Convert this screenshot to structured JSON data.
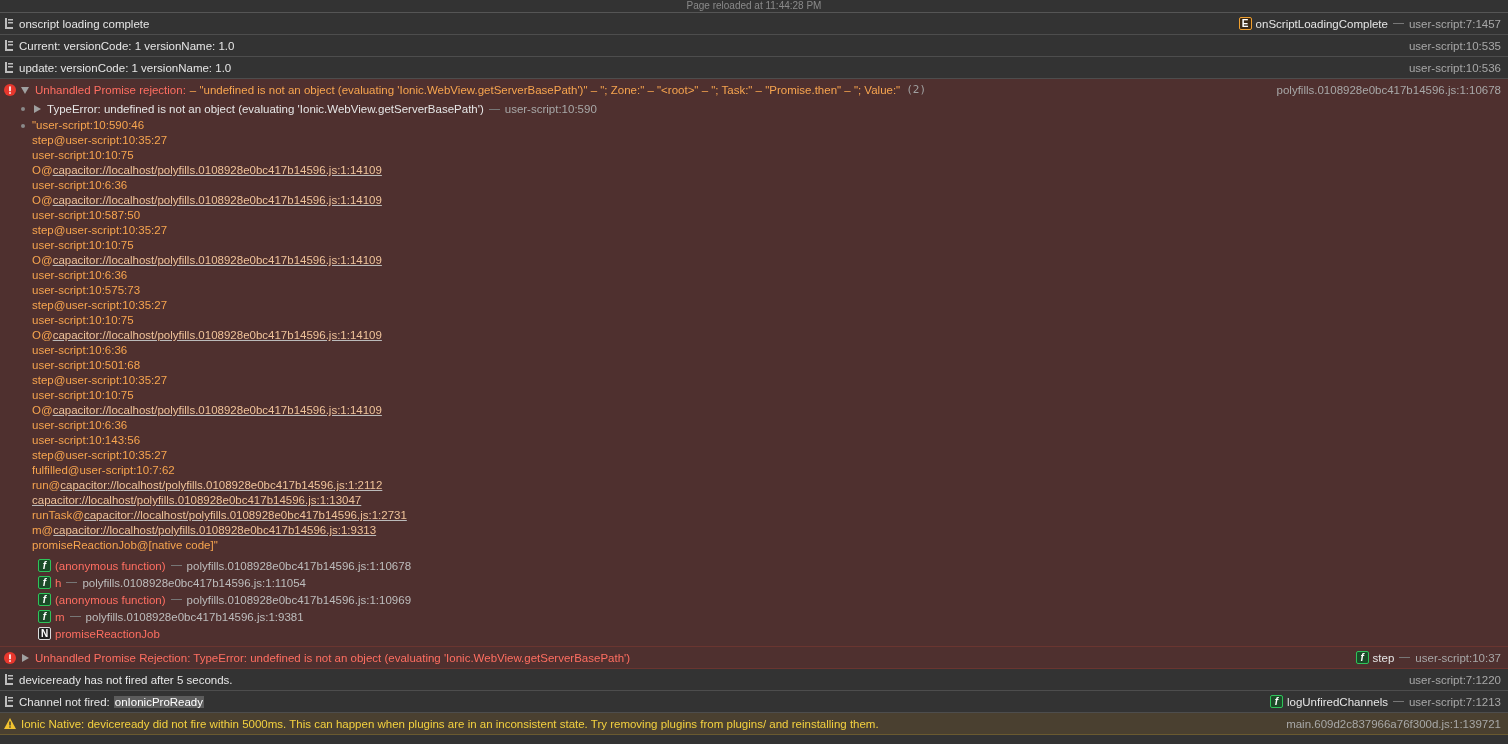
{
  "reload_notice": "Page reloaded at 11:44:28 PM",
  "messages": [
    {
      "kind": "log",
      "text": "onscript loading complete",
      "badge": {
        "kind": "event",
        "letter": "E"
      },
      "function": "onScriptLoadingComplete",
      "location": "user-script:7:1457"
    },
    {
      "kind": "log",
      "text": "Current: versionCode: 1 versionName: 1.0",
      "location": "user-script:10:535"
    },
    {
      "kind": "log",
      "text": "update: versionCode: 1 versionName: 1.0",
      "location": "user-script:10:536"
    },
    {
      "kind": "error",
      "expanded": true,
      "title": "Unhandled Promise rejection:",
      "text": "– \"undefined is not an object (evaluating 'Ionic.WebView.getServerBasePath')\" – \"; Zone:\" – \"<root>\" – \"; Task:\" – \"Promise.then\" – \"; Value:\"",
      "count": "(2)",
      "location": "polyfills.0108928e0bc417b14596.js:1:10678",
      "detail": {
        "expanded": false,
        "text": "TypeError: undefined is not an object (evaluating 'Ionic.WebView.getServerBasePath')",
        "location": "user-script:10:590"
      },
      "stack": [
        {
          "prefix": "\"user-script:10:590:46"
        },
        {
          "prefix": "step@user-script:10:35:27"
        },
        {
          "prefix": "user-script:10:10:75"
        },
        {
          "prefix": "O@",
          "link": "capacitor://localhost/polyfills.0108928e0bc417b14596.js:1:14109"
        },
        {
          "prefix": "user-script:10:6:36"
        },
        {
          "prefix": "O@",
          "link": "capacitor://localhost/polyfills.0108928e0bc417b14596.js:1:14109"
        },
        {
          "prefix": "user-script:10:587:50"
        },
        {
          "prefix": "step@user-script:10:35:27"
        },
        {
          "prefix": "user-script:10:10:75"
        },
        {
          "prefix": "O@",
          "link": "capacitor://localhost/polyfills.0108928e0bc417b14596.js:1:14109"
        },
        {
          "prefix": "user-script:10:6:36"
        },
        {
          "prefix": "user-script:10:575:73"
        },
        {
          "prefix": "step@user-script:10:35:27"
        },
        {
          "prefix": "user-script:10:10:75"
        },
        {
          "prefix": "O@",
          "link": "capacitor://localhost/polyfills.0108928e0bc417b14596.js:1:14109"
        },
        {
          "prefix": "user-script:10:6:36"
        },
        {
          "prefix": "user-script:10:501:68"
        },
        {
          "prefix": "step@user-script:10:35:27"
        },
        {
          "prefix": "user-script:10:10:75"
        },
        {
          "prefix": "O@",
          "link": "capacitor://localhost/polyfills.0108928e0bc417b14596.js:1:14109"
        },
        {
          "prefix": "user-script:10:6:36"
        },
        {
          "prefix": "user-script:10:143:56"
        },
        {
          "prefix": "step@user-script:10:35:27"
        },
        {
          "prefix": "fulfilled@user-script:10:7:62"
        },
        {
          "prefix": "run@",
          "link": "capacitor://localhost/polyfills.0108928e0bc417b14596.js:1:2112"
        },
        {
          "link": "capacitor://localhost/polyfills.0108928e0bc417b14596.js:1:13047"
        },
        {
          "prefix": "runTask@",
          "link": "capacitor://localhost/polyfills.0108928e0bc417b14596.js:1:2731"
        },
        {
          "prefix": "m@",
          "link": "capacitor://localhost/polyfills.0108928e0bc417b14596.js:1:9313"
        },
        {
          "prefix": "promiseReactionJob@[native code]\""
        }
      ],
      "frames": [
        {
          "badge": {
            "kind": "function",
            "letter": "f"
          },
          "name": "(anonymous function)",
          "location": "polyfills.0108928e0bc417b14596.js:1:10678"
        },
        {
          "badge": {
            "kind": "function",
            "letter": "f"
          },
          "name": "h",
          "location": "polyfills.0108928e0bc417b14596.js:1:11054"
        },
        {
          "badge": {
            "kind": "function",
            "letter": "f"
          },
          "name": "(anonymous function)",
          "location": "polyfills.0108928e0bc417b14596.js:1:10969"
        },
        {
          "badge": {
            "kind": "function",
            "letter": "f"
          },
          "name": "m",
          "location": "polyfills.0108928e0bc417b14596.js:1:9381"
        },
        {
          "badge": {
            "kind": "native",
            "letter": "N"
          },
          "name": "promiseReactionJob"
        }
      ]
    },
    {
      "kind": "error",
      "expanded": false,
      "text": "Unhandled Promise Rejection: TypeError: undefined is not an object (evaluating 'Ionic.WebView.getServerBasePath')",
      "badge": {
        "kind": "function",
        "letter": "f"
      },
      "function": "step",
      "location": "user-script:10:37"
    },
    {
      "kind": "log",
      "text": "deviceready has not fired after 5 seconds.",
      "location": "user-script:7:1220"
    },
    {
      "kind": "log",
      "text": "Channel not fired:",
      "highlight": "onIonicProReady",
      "badge": {
        "kind": "function",
        "letter": "f"
      },
      "function": "logUnfiredChannels",
      "location": "user-script:7:1213"
    },
    {
      "kind": "warning",
      "text": "Ionic Native: deviceready did not fire within 5000ms. This can happen when plugins are in an inconsistent state. Try removing plugins from plugins/ and reinstalling them.",
      "location": "main.609d2c837966a76f300d.js:1:139721"
    }
  ]
}
